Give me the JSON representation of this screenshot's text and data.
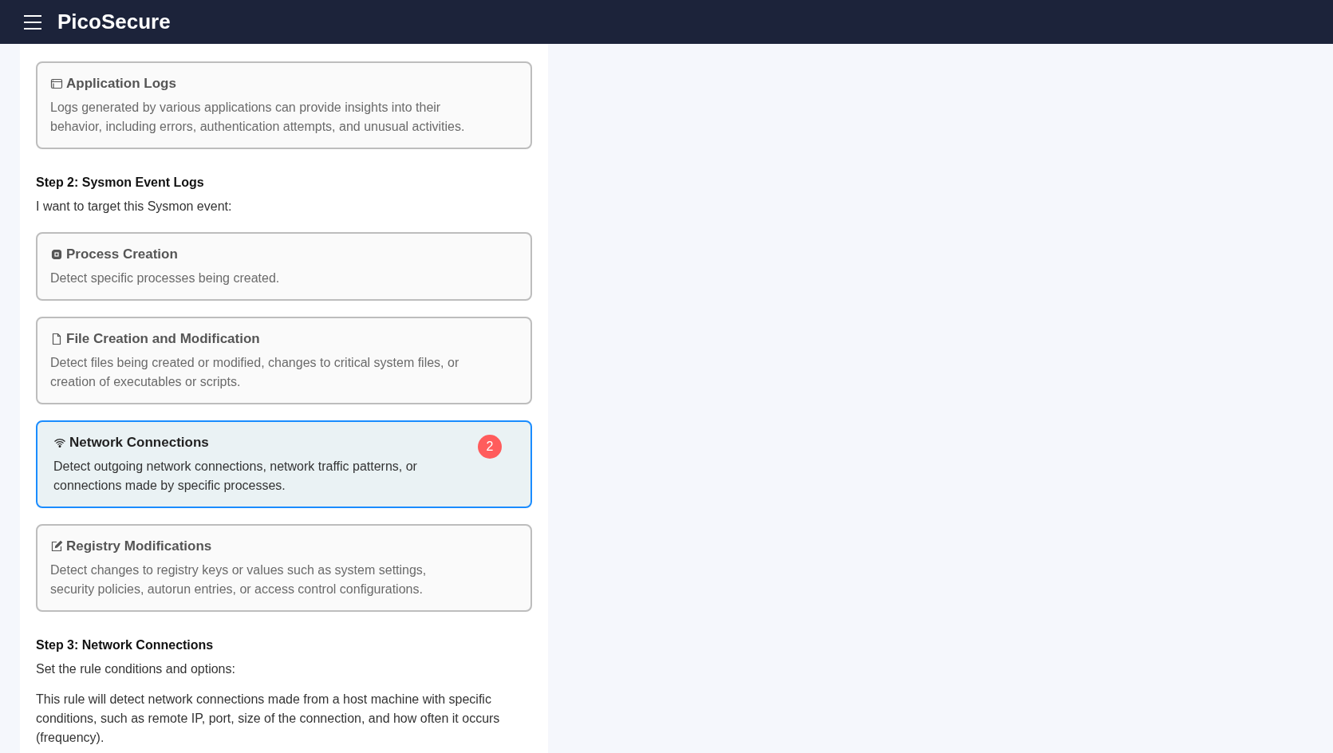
{
  "header": {
    "title": "PicoSecure"
  },
  "log_sources": [
    {
      "kind": "window",
      "title": "Application Logs",
      "description": "Logs generated by various applications can provide insights into their behavior, including errors, authentication attempts, and unusual activities.",
      "selected": false
    }
  ],
  "step2": {
    "heading": "Step 2: Sysmon Event Logs",
    "prompt": "I want to target this Sysmon event:"
  },
  "events": [
    {
      "kind": "chip",
      "title": "Process Creation",
      "description": "Detect specific processes being created.",
      "selected": false
    },
    {
      "kind": "file",
      "title": "File Creation and Modification",
      "description": "Detect files being created or modified, changes to critical system files, or creation of executables or scripts.",
      "selected": false
    },
    {
      "kind": "wifi",
      "title": "Network Connections",
      "description": "Detect outgoing network connections, network traffic patterns, or connections made by specific processes.",
      "selected": true,
      "badge": "2"
    },
    {
      "kind": "edit",
      "title": "Registry Modifications",
      "description": "Detect changes to registry keys or values such as system settings, security policies, autorun entries, or access control configurations.",
      "selected": false
    }
  ],
  "step3": {
    "heading": "Step 3: Network Connections",
    "prompt": "Set the rule conditions and options:",
    "paragraph": "This rule will detect network connections made from a host machine with specific conditions, such as remote IP, port, size of the connection, and how often it occurs (frequency)."
  }
}
